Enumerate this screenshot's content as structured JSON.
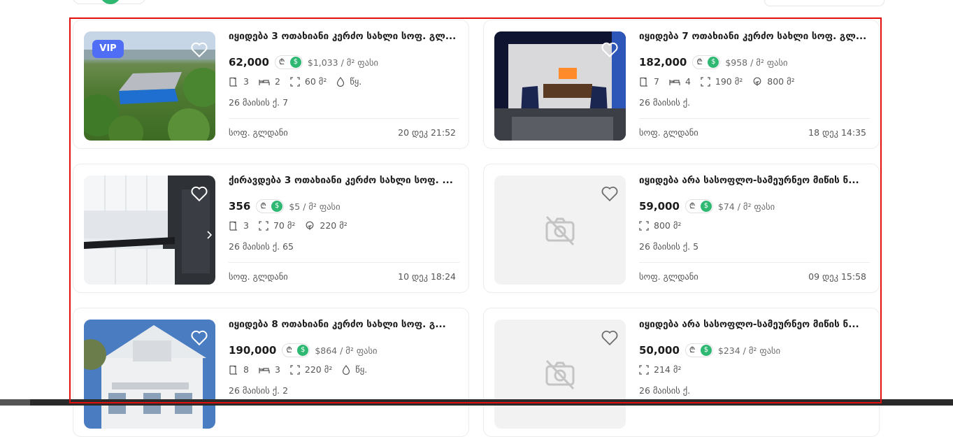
{
  "badges": {
    "vip": "VIP"
  },
  "currency": {
    "gel_symbol": "₾",
    "usd_symbol": "$"
  },
  "colors": {
    "accent_green": "#2eb872",
    "vip_blue": "#4f6df5",
    "highlight_red": "#e01010"
  },
  "listings": [
    {
      "title": "იყიდება 3 ოთახიანი კერძო სახლი სოფ. გლ...",
      "price": "62,000",
      "sqm_price": "$1,033 / მ² ფასი",
      "specs": [
        {
          "icon": "door-icon",
          "value": "3"
        },
        {
          "icon": "bed-icon",
          "value": "2"
        },
        {
          "icon": "area-icon",
          "value": "60 მ²"
        },
        {
          "icon": "drop-icon",
          "value": "წყ."
        }
      ],
      "address": "26 მაისის ქ. 7",
      "location": "სოფ. გლდანი",
      "date": "20 დეკ 21:52",
      "vip": true
    },
    {
      "title": "იყიდება 7 ოთახიანი კერძო სახლი სოფ. გლ...",
      "price": "182,000",
      "sqm_price": "$958 / მ² ფასი",
      "specs": [
        {
          "icon": "door-icon",
          "value": "7"
        },
        {
          "icon": "bed-icon",
          "value": "4"
        },
        {
          "icon": "area-icon",
          "value": "190 მ²"
        },
        {
          "icon": "tree-icon",
          "value": "800 მ²"
        }
      ],
      "address": "26 მაისის ქ.",
      "location": "სოფ. გლდანი",
      "date": "18 დეკ 14:35",
      "vip": false
    },
    {
      "title": "ქირავდება 3 ოთახიანი კერძო სახლი სოფ. ...",
      "price": "356",
      "sqm_price": "$5 / მ² ფასი",
      "specs": [
        {
          "icon": "door-icon",
          "value": "3"
        },
        {
          "icon": "area-icon",
          "value": "70 მ²"
        },
        {
          "icon": "tree-icon",
          "value": "220 მ²"
        }
      ],
      "address": "26 მაისის ქ. 65",
      "location": "სოფ. გლდანი",
      "date": "10 დეკ 18:24",
      "vip": false
    },
    {
      "title": "იყიდება არა სასოფლო-სამეურნეო მიწის ნ...",
      "price": "59,000",
      "sqm_price": "$74 / მ² ფასი",
      "specs": [
        {
          "icon": "area-icon",
          "value": "800 მ²"
        }
      ],
      "address": "26 მაისის ქ. 5",
      "location": "სოფ. გლდანი",
      "date": "09 დეკ 15:58",
      "vip": false
    },
    {
      "title": "იყიდება 8 ოთახიანი კერძო სახლი სოფ. გ...",
      "price": "190,000",
      "sqm_price": "$864 / მ² ფასი",
      "specs": [
        {
          "icon": "door-icon",
          "value": "8"
        },
        {
          "icon": "bed-icon",
          "value": "3"
        },
        {
          "icon": "area-icon",
          "value": "220 მ²"
        },
        {
          "icon": "drop-icon",
          "value": "წყ."
        }
      ],
      "address": "26 მაისის ქ. 2",
      "location": "",
      "date": "",
      "vip": false
    },
    {
      "title": "იყიდება არა სასოფლო-სამეურნეო მიწის ნ...",
      "price": "50,000",
      "sqm_price": "$234 / მ² ფასი",
      "specs": [
        {
          "icon": "area-icon",
          "value": "214 მ²"
        }
      ],
      "address": "26 მაისის ქ.",
      "location": "",
      "date": "",
      "vip": false
    }
  ]
}
